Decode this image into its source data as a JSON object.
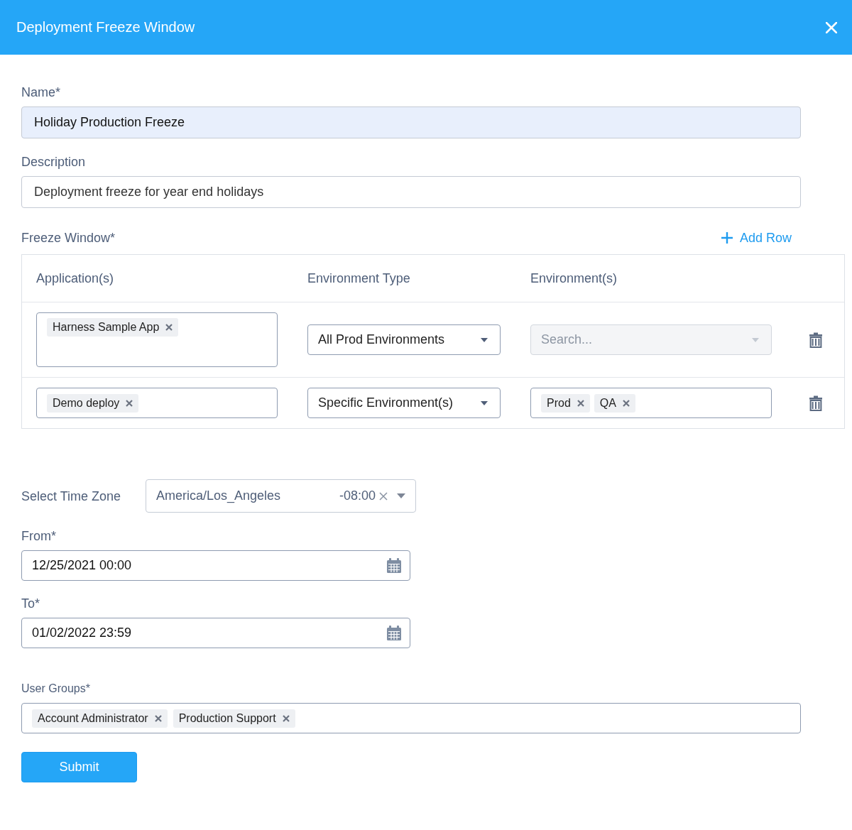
{
  "dialog": {
    "title": "Deployment Freeze Window"
  },
  "name_field": {
    "label": "Name*",
    "value": "Holiday Production Freeze",
    "focused": true
  },
  "description_field": {
    "label": "Description",
    "value": "Deployment freeze for year end holidays",
    "focused": false
  },
  "freeze_window": {
    "label": "Freeze Window*",
    "add_row": "Add Row",
    "columns": [
      "Application(s)",
      "Environment Type",
      "Environment(s)"
    ],
    "rows": [
      {
        "applications": [
          "Harness Sample App"
        ],
        "environment_type": "All Prod Environments",
        "environments": {
          "placeholder": "Search...",
          "disabled": true
        }
      },
      {
        "applications": [
          "Demo deploy"
        ],
        "environment_type": "Specific Environment(s)",
        "environments": {
          "tags": [
            "Prod",
            "QA"
          ],
          "disabled": false
        }
      }
    ]
  },
  "time_zone": {
    "label": "Select Time Zone",
    "value": "America/Los_Angeles",
    "offset": "-08:00"
  },
  "from_field": {
    "label": "From*",
    "value": "12/25/2021 00:00"
  },
  "to_field": {
    "label": "To*",
    "value": "01/02/2022 23:59"
  },
  "user_groups": {
    "label": "User Groups*",
    "tags": [
      "Account Administrator",
      "Production Support"
    ]
  },
  "submit": "Submit"
}
